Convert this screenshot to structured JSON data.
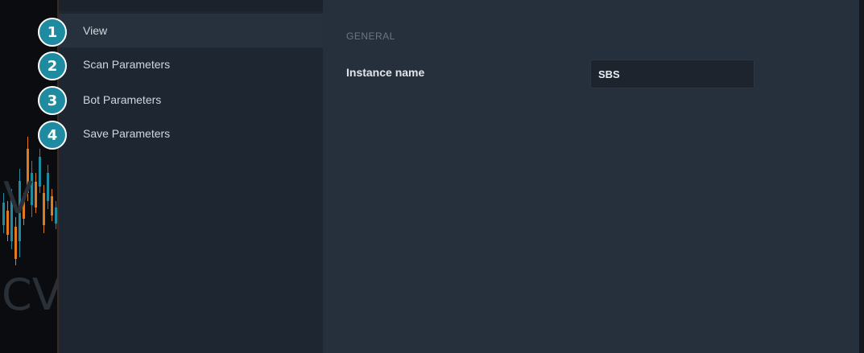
{
  "background_chart": {
    "letters": [
      "V",
      "CV"
    ],
    "up_color": "#1f8ba0",
    "down_color": "#e07a1f"
  },
  "badges": [
    "1",
    "2",
    "3",
    "4"
  ],
  "sidebar": {
    "items": [
      {
        "label": "View",
        "active": true
      },
      {
        "label": "Scan Parameters",
        "active": false
      },
      {
        "label": "Bot Parameters",
        "active": false
      },
      {
        "label": "Save Parameters",
        "active": false
      }
    ]
  },
  "main": {
    "section_title": "GENERAL",
    "fields": [
      {
        "label": "Instance name",
        "value": "SBS"
      }
    ]
  },
  "colors": {
    "badge": "#1f8ba0",
    "dialog": "#232c37",
    "sidebar": "#1e2631",
    "active_item": "#27313d"
  }
}
